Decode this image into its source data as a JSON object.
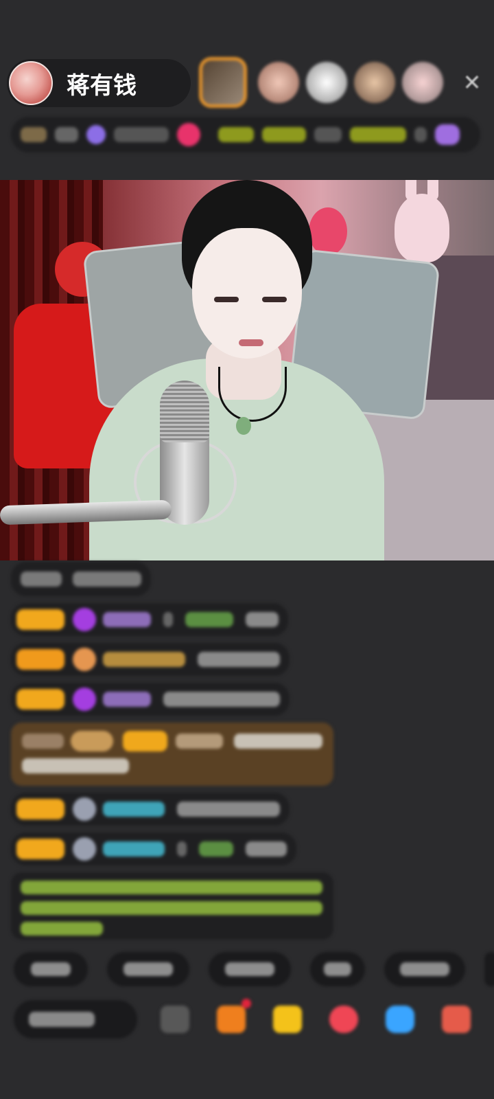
{
  "header": {
    "host_name": "蒋有钱",
    "host_avatar_icon": "host-avatar",
    "viewers": [
      "top-viewer-1",
      "viewer-2",
      "viewer-3",
      "viewer-4",
      "viewer-5"
    ],
    "close_icon": "close-icon",
    "close_glyph": "✕"
  },
  "info_bar": {
    "accent_color": "#e8336b",
    "tag_color": "#8e9a1e"
  },
  "video": {
    "description_icon": "live-video-stream"
  },
  "chat": {
    "messages": [
      {
        "type": "system"
      },
      {
        "type": "user",
        "badge_color": "#f1a81d",
        "icon": "purple-gem-icon"
      },
      {
        "type": "user",
        "badge_color": "#f09a1c",
        "icon": "bag-icon"
      },
      {
        "type": "user",
        "badge_color": "#f1a81d",
        "icon": "purple-gem-icon"
      },
      {
        "type": "gift",
        "bg_color": "#5a4124"
      },
      {
        "type": "user",
        "badge_color": "#f1a81d",
        "icon": "grey-avatar-icon"
      },
      {
        "type": "user",
        "badge_color": "#f1a81d",
        "icon": "grey-avatar-icon"
      },
      {
        "type": "notice",
        "text_color": "#82a63a"
      }
    ]
  },
  "quick_replies": {
    "count": 6
  },
  "bottom_bar": {
    "icons": [
      "emoji-icon",
      "box-icon",
      "gift-icon",
      "red-packet-icon",
      "message-icon",
      "more-grid-icon"
    ],
    "notification_dot_color": "#e0243c"
  }
}
